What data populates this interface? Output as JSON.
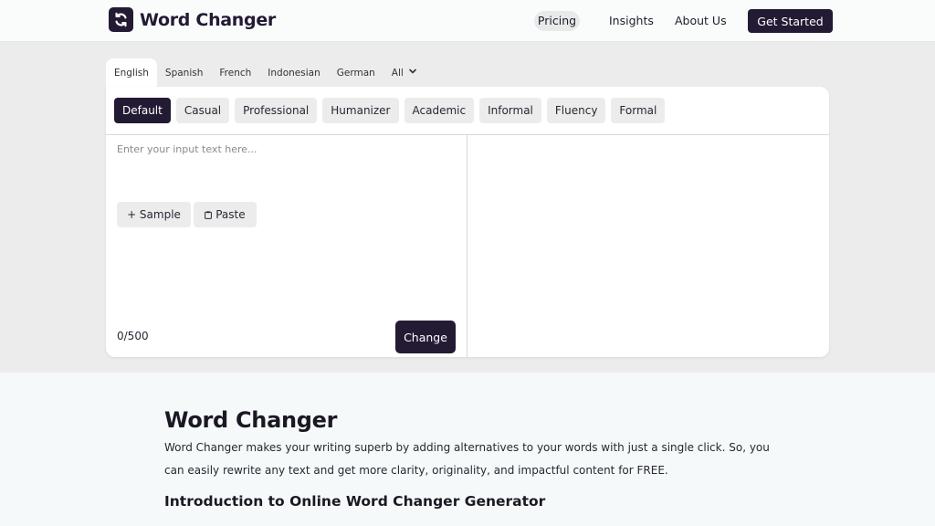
{
  "header": {
    "logo_text": "Word Changer",
    "nav": {
      "pricing": "Pricing",
      "insights": "Insights",
      "about": "About Us"
    },
    "cta": "Get Started"
  },
  "languages": {
    "tabs": [
      "English",
      "Spanish",
      "French",
      "Indonesian",
      "German"
    ],
    "active": "English",
    "all_label": "All"
  },
  "modes": {
    "items": [
      "Default",
      "Casual",
      "Professional",
      "Humanizer",
      "Academic",
      "Informal",
      "Fluency",
      "Formal"
    ],
    "active": "Default"
  },
  "editor": {
    "placeholder": "Enter your input text here...",
    "value": "",
    "sample_label": "+ Sample",
    "paste_label": "Paste",
    "counter": "0/500",
    "submit_label": "Change"
  },
  "article": {
    "title": "Word Changer",
    "intro": "Word Changer makes your writing superb by adding alternatives to your words with just a single click. So, you can easily rewrite any text and get more clarity, originality, and impactful content for FREE.",
    "subtitle": "Introduction to Online Word Changer Generator"
  },
  "colors": {
    "brand": "#231a34",
    "chip_bg": "#ececec",
    "page_bg": "#f5f9f9"
  },
  "icons": {
    "logo": "refresh-arrows-icon",
    "dropdown": "chevron-down-icon",
    "paste": "clipboard-icon"
  }
}
